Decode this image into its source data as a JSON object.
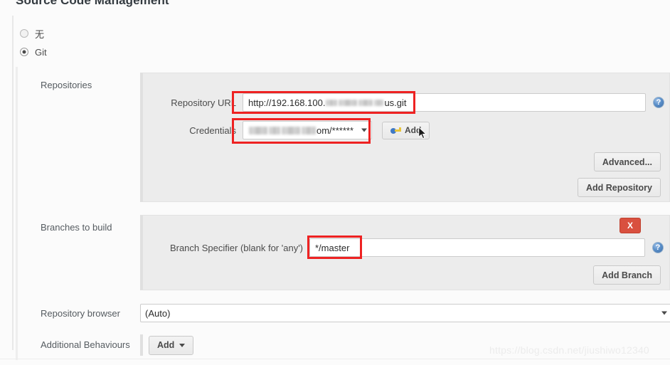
{
  "page": {
    "title": "Source Code Management",
    "watermark": "https://blog.csdn.net/jiushiwo12340"
  },
  "scm_type": {
    "options": [
      {
        "label": "无",
        "selected": false
      },
      {
        "label": "Git",
        "selected": true
      }
    ]
  },
  "repositories": {
    "section_label": "Repositories",
    "repository_url": {
      "label": "Repository URL",
      "value_prefix": "http://192.168.100.",
      "value_suffix": "us.git",
      "redacted": true
    },
    "credentials": {
      "label": "Credentials",
      "value_suffix": "om/******",
      "redacted": true,
      "add_button": "Add"
    },
    "advanced_button": "Advanced...",
    "add_repository_button": "Add Repository",
    "help_icon": "help-icon"
  },
  "branches": {
    "section_label": "Branches to build",
    "branch_specifier": {
      "label": "Branch Specifier (blank for 'any')",
      "value": "*/master"
    },
    "delete_button": "X",
    "add_branch_button": "Add Branch",
    "help_icon": "help-icon"
  },
  "repository_browser": {
    "label": "Repository browser",
    "selected": "(Auto)",
    "options": [
      "(Auto)"
    ]
  },
  "additional_behaviours": {
    "label": "Additional Behaviours",
    "add_button": "Add"
  },
  "colors": {
    "danger": "#d9503f",
    "annotation": "#ee2222",
    "help": "#3e6ea8",
    "panel_bg": "#ececec"
  }
}
